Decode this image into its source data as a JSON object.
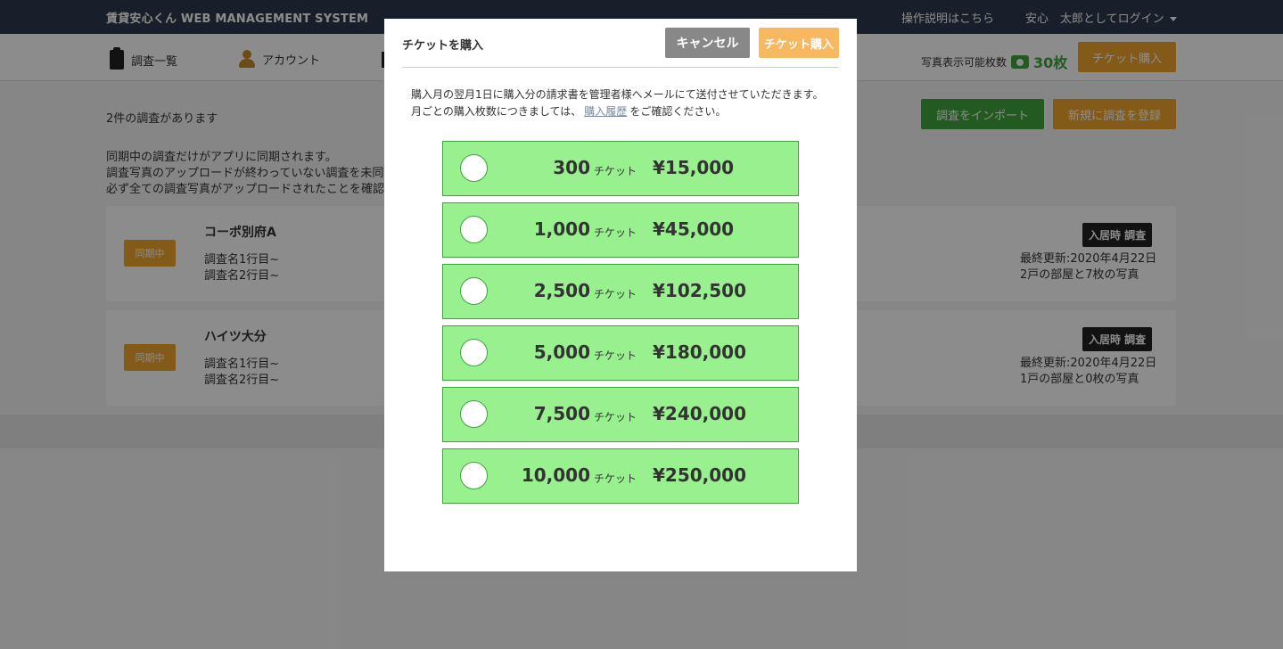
{
  "app": {
    "brand": "賃貸安心くん WEB MANAGEMENT SYSTEM",
    "help_link": "操作説明はこちら",
    "user_label": "安心　太郎としてログイン"
  },
  "nav": {
    "items": [
      {
        "label": "調査一覧",
        "icon": "clipboard-icon"
      },
      {
        "label": "アカウント",
        "icon": "person-icon"
      }
    ],
    "quota_label": "写真表示可能枚数",
    "quota_count": "30枚",
    "buy_ticket": "チケット購入"
  },
  "main": {
    "count_text": "2件の調査があります",
    "import_button": "調査をインポート",
    "new_button": "新規に調査を登録",
    "notice": [
      "同期中の調査だけがアプリに同期されます。",
      "調査写真のアップロードが終わっていない調査を未同",
      "必ず全ての調査写真がアップロードされたことを確認"
    ],
    "surveys": [
      {
        "badge": "同期中",
        "name": "コーポ別府A",
        "line1": "調査名1行目~",
        "line2": "調査名2行目~",
        "type": "入居時 調査",
        "updated": "最終更新:2020年4月22日",
        "rooms": "2戸の部屋と7枚の写真"
      },
      {
        "badge": "同期中",
        "name": "ハイツ大分",
        "line1": "調査名1行目~",
        "line2": "調査名2行目~",
        "type": "入居時 調査",
        "updated": "最終更新:2020年4月22日",
        "rooms": "1戸の部屋と0枚の写真"
      }
    ]
  },
  "modal": {
    "title": "チケットを購入",
    "cancel": "キャンセル",
    "buy": "チケット購入",
    "desc_line1": "購入月の翌月1日に購入分の請求書を管理者様へメールにて送付させていただきます。",
    "desc_line2_a": "月ごとの購入枚数につきましては、",
    "desc_link": "購入履歴",
    "desc_line2_b": "をご確認ください。",
    "options": [
      {
        "qty": "300",
        "unit": "チケット",
        "price": "¥15,000"
      },
      {
        "qty": "1,000",
        "unit": "チケット",
        "price": "¥45,000"
      },
      {
        "qty": "2,500",
        "unit": "チケット",
        "price": "¥102,500"
      },
      {
        "qty": "5,000",
        "unit": "チケット",
        "price": "¥180,000"
      },
      {
        "qty": "7,500",
        "unit": "チケット",
        "price": "¥240,000"
      },
      {
        "qty": "10,000",
        "unit": "チケット",
        "price": "¥250,000"
      }
    ]
  },
  "colors": {
    "green": "#3ea53e",
    "option_bg": "#98f08f",
    "orange": "#f0a52c",
    "navy": "#2d3a4d"
  }
}
